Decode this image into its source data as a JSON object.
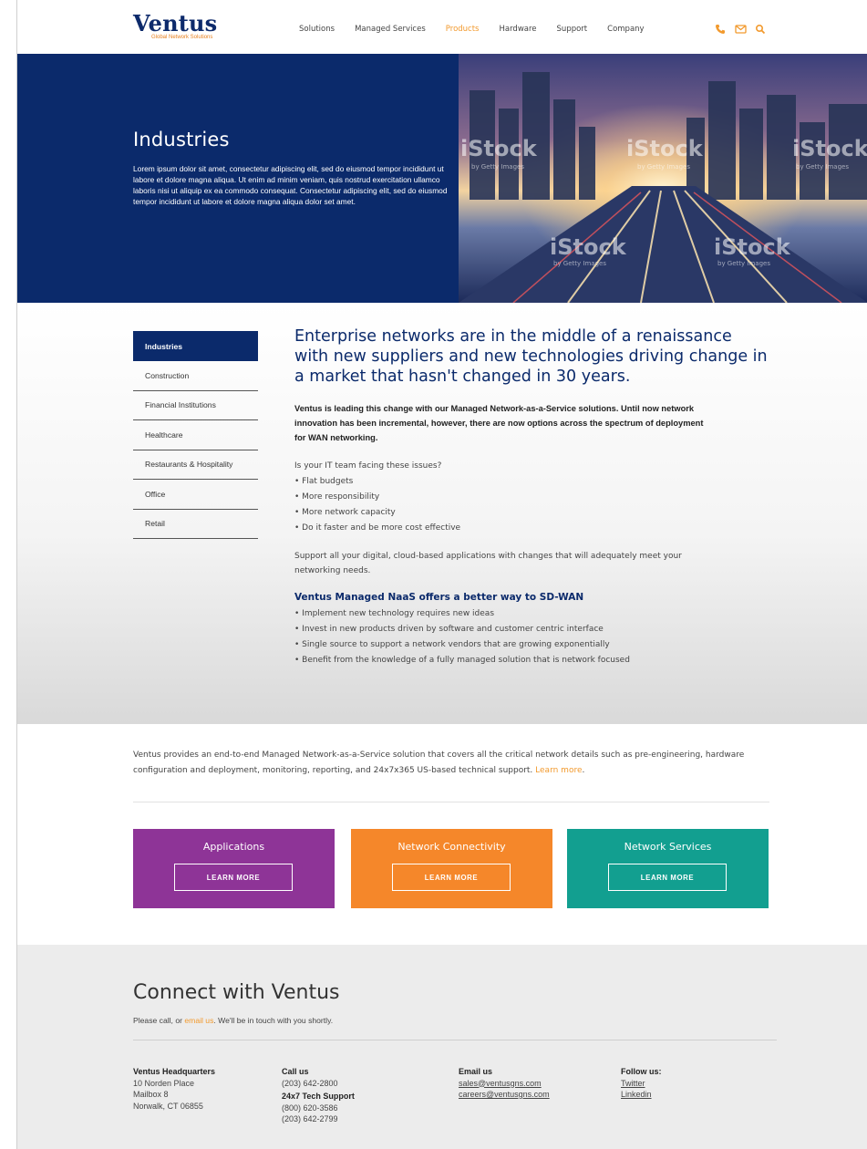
{
  "header": {
    "logo": "Ventus",
    "logo_tagline": "Global Network Solutions",
    "nav": [
      "Solutions",
      "Managed Services",
      "Products",
      "Hardware",
      "Support",
      "Company"
    ],
    "active_nav": "Products",
    "icons": [
      "phone-icon",
      "mail-icon",
      "search-icon"
    ],
    "accent_color": "#f29a2e"
  },
  "hero": {
    "title": "Industries",
    "text": "Lorem ipsum dolor sit amet, consectetur adipiscing elit, sed do eiusmod tempor incididunt ut labore et dolore magna aliqua. Ut enim ad minim veniam, quis nostrud exercitation ullamco laboris nisi ut aliquip ex ea commodo consequat. Consectetur adipiscing elit, sed do eiusmod tempor incididunt ut labore et dolore magna aliqua dolor set amet.",
    "watermark": "iStock",
    "watermark_sub": "by Getty Images",
    "bg_color": "#0b2a6b"
  },
  "sidebar": {
    "items": [
      "Industries",
      "Construction",
      "Financial Institutions",
      "Healthcare",
      "Restaurants & Hospitality",
      "Office",
      "Retail"
    ],
    "active": "Industries"
  },
  "main": {
    "lead": "Enterprise networks are in the middle of a renaissance with new suppliers and new technologies driving change in a market that hasn't changed in 30 years.",
    "intro": "Ventus is leading this change with our Managed Network-as-a-Service solutions. Until now network innovation has been incremental, however, there are now options across the spectrum of deployment for WAN networking.",
    "issues_heading": "Is your IT team facing these issues?",
    "issues": [
      "• Flat budgets",
      "• More responsibility",
      "• More network capacity",
      "• Do it faster and be more cost effective"
    ],
    "support": "Support all your digital, cloud-based applications with changes that will adequately meet your networking needs.",
    "naas_heading": "Ventus Managed NaaS offers a better way to SD-WAN",
    "naas": [
      "• Implement new technology requires new ideas",
      "• Invest in new products driven by software and customer centric interface",
      "• Single source to support a network vendors that are growing exponentially",
      "• Benefit from the knowledge of a fully managed solution that is network focused"
    ]
  },
  "services": {
    "text": "Ventus provides an end-to-end Managed Network-as-a-Service solution that covers all the critical network details such as pre-engineering, hardware configuration and deployment, monitoring, reporting, and 24x7x365 US-based technical support. ",
    "link": "Learn more",
    "link_suffix": ".",
    "cards": [
      {
        "title": "Applications",
        "button": "LEARN MORE",
        "color": "#8e3497"
      },
      {
        "title": "Network Connectivity",
        "button": "LEARN MORE",
        "color": "#f5872a"
      },
      {
        "title": "Network Services",
        "button": "LEARN MORE",
        "color": "#129f90"
      }
    ]
  },
  "footer": {
    "title": "Connect with Ventus",
    "sub_prefix": "Please call, or ",
    "sub_link": "email us",
    "sub_suffix": ". We'll be in touch with you shortly.",
    "hq": {
      "heading": "Ventus Headquarters",
      "lines": [
        "10 Norden Place",
        "Mailbox 8",
        "Norwalk, CT 06855"
      ]
    },
    "call": {
      "heading": "Call us",
      "phone": "(203) 642-2800",
      "support_heading": "24x7 Tech Support",
      "support_phones": [
        "(800) 620-3586",
        "(203) 642-2799"
      ]
    },
    "email": {
      "heading": "Email us",
      "addresses": [
        "sales@ventusgns.com",
        "careers@ventusgns.com"
      ]
    },
    "follow": {
      "heading": "Follow us:",
      "links": [
        "Twitter",
        "Linkedin"
      ]
    }
  }
}
